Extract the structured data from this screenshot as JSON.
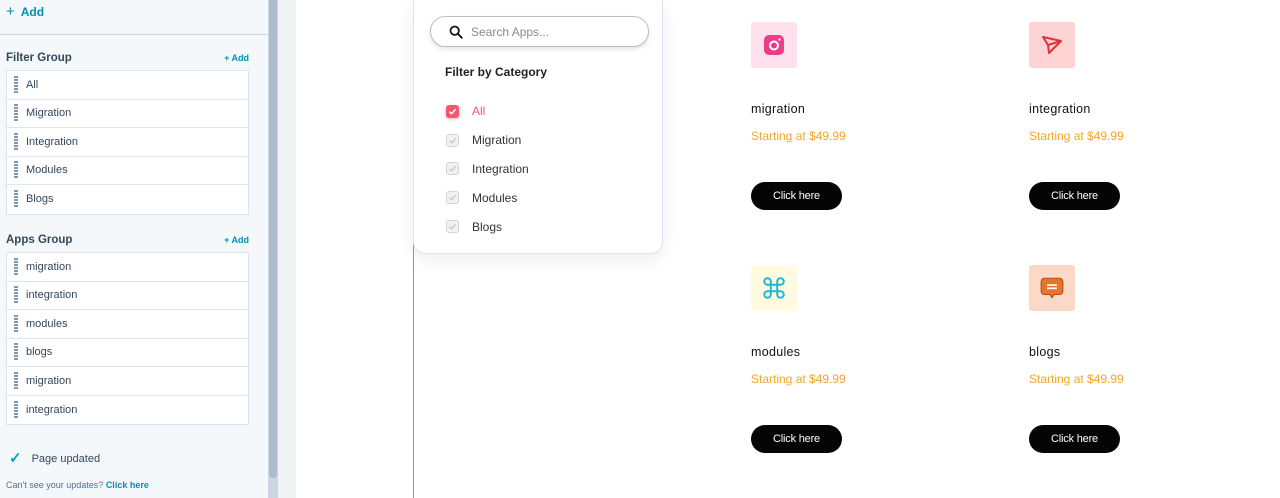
{
  "sidebar": {
    "top_add_label": "Add",
    "filter_group": {
      "title": "Filter Group",
      "add_label": "+ Add",
      "items": [
        "All",
        "Migration",
        "Integration",
        "Modules",
        "Blogs"
      ]
    },
    "apps_group": {
      "title": "Apps Group",
      "add_label": "+ Add",
      "items": [
        "migration",
        "integration",
        "modules",
        "blogs",
        "migration",
        "integration"
      ]
    },
    "status": "Page updated",
    "help_text": "Can't see your updates?",
    "help_link": "Click here"
  },
  "filter_panel": {
    "search_placeholder": "Search Apps...",
    "title": "Filter by Category",
    "categories": [
      {
        "label": "All",
        "checked": true
      },
      {
        "label": "Migration",
        "checked": false
      },
      {
        "label": "Integration",
        "checked": false
      },
      {
        "label": "Modules",
        "checked": false
      },
      {
        "label": "Blogs",
        "checked": false
      }
    ]
  },
  "apps": [
    {
      "name": "migration",
      "price": "Starting at $49.99",
      "button": "Click here",
      "icon": "camera-icon",
      "icon_bg": "#fde1ec",
      "icon_color": "#ec3d8a"
    },
    {
      "name": "integration",
      "price": "Starting at $49.99",
      "button": "Click here",
      "icon": "paper-plane-icon",
      "icon_bg": "#fdd3d3",
      "icon_color": "#e0313d"
    },
    {
      "name": "modules",
      "price": "Starting at $49.99",
      "button": "Click here",
      "icon": "command-icon",
      "icon_bg": "#fffbe0",
      "icon_color": "#1fb6d6"
    },
    {
      "name": "blogs",
      "price": "Starting at $49.99",
      "button": "Click here",
      "icon": "chat-bubble-icon",
      "icon_bg": "#fcd9c6",
      "icon_color": "#e8742d"
    }
  ],
  "colors": {
    "accent": "#0091ae",
    "price": "#f5a623",
    "checkbox_on": "#ef5b6e",
    "button": "#050505"
  }
}
